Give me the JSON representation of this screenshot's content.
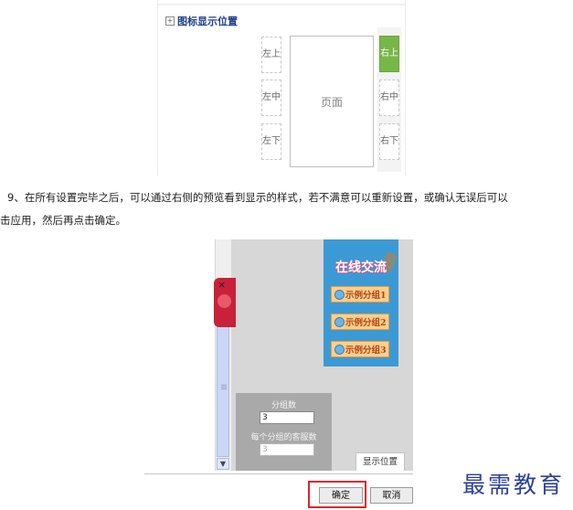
{
  "top_panel": {
    "section_title": "图标显示位置",
    "positions": {
      "left_top": "左上",
      "left_middle": "左中",
      "left_bottom": "左下",
      "right_top": "右上",
      "right_middle": "右中",
      "right_bottom": "右下"
    },
    "page_label": "页面",
    "selected_position": "right_top"
  },
  "instructions": {
    "line1": "9、在所有设置完毕之后，可以通过右侧的预览看到显示的样式，若不满意可以重新设置，或确认无误后可以",
    "line2": "击应用，然后再点击确定。"
  },
  "preview": {
    "widget_title": "在线交流",
    "groups": [
      "示例分组1",
      "示例分组2",
      "示例分组3"
    ],
    "close_symbol": "×",
    "settings": {
      "group_count_label": "分组数",
      "group_count_value": "3",
      "agents_per_group_label": "每个分组的客服数",
      "agents_per_group_value": "3"
    },
    "tab_label": "显示位置"
  },
  "dialog": {
    "ok_label": "确定",
    "cancel_label": "取消"
  },
  "watermark": "最需教育",
  "colors": {
    "active_position": "#77b747",
    "widget_background": "#3b9ad6",
    "highlight_border": "#e0232f",
    "watermark": "#2b3f9e"
  }
}
